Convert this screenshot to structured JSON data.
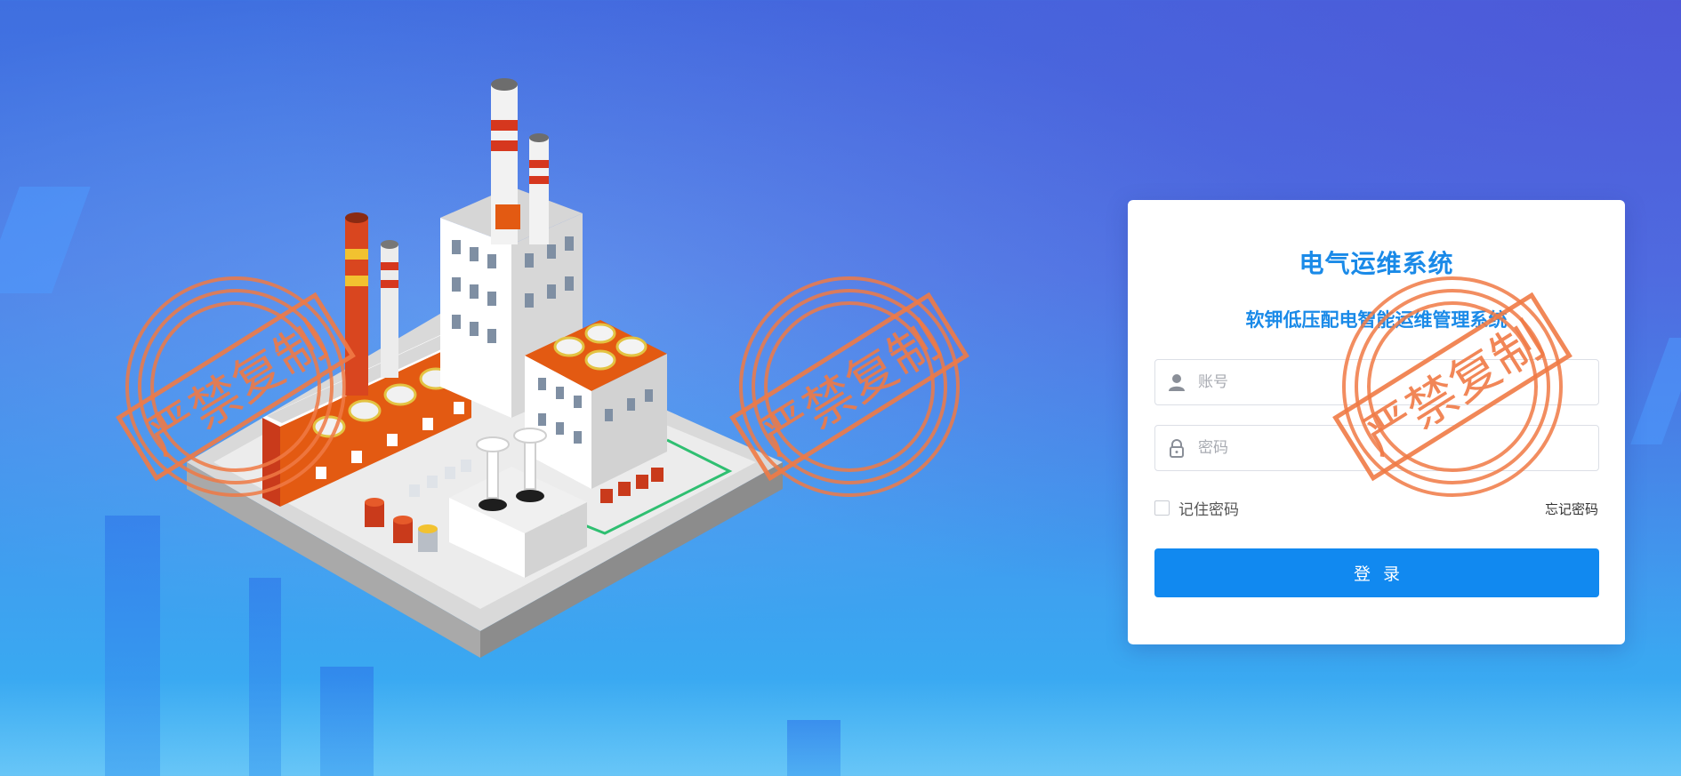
{
  "login": {
    "title": "电气运维系统",
    "subtitle": "软钾低压配电智能运维管理系统",
    "username_placeholder": "账号",
    "password_placeholder": "密码",
    "remember_label": "记住密码",
    "forgot_label": "忘记密码",
    "submit_label": "登录"
  },
  "watermark": {
    "text": "严禁复制",
    "color": "#f07a45"
  },
  "icons": {
    "user": "user-icon",
    "lock": "lock-icon"
  },
  "colors": {
    "accent": "#1189f0",
    "title": "#1a8ae8"
  }
}
